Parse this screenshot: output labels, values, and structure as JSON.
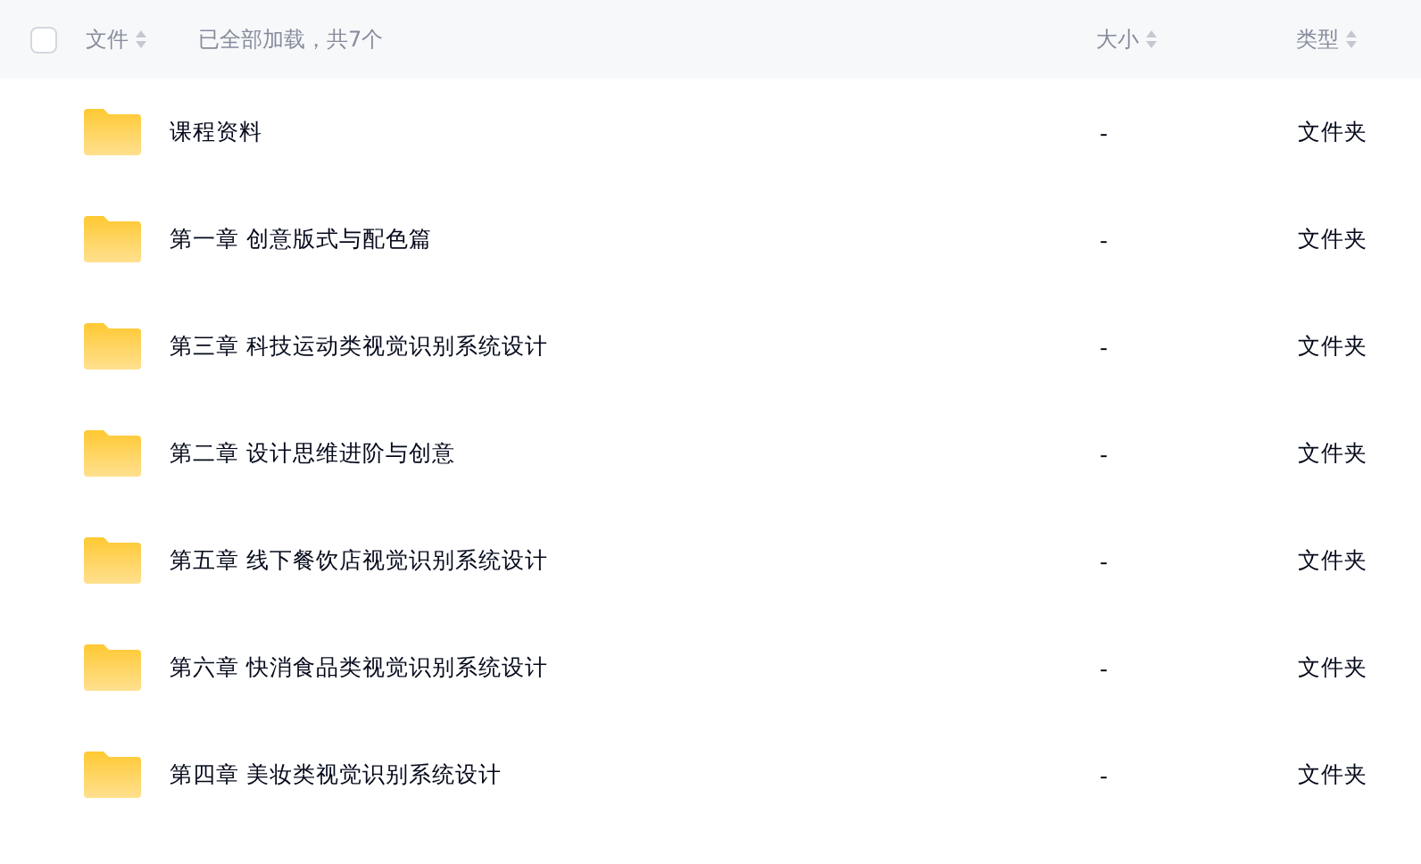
{
  "header": {
    "select_all": {
      "checked": false
    },
    "name_label": "文件",
    "status": "已全部加载，共7个",
    "size_label": "大小",
    "type_label": "类型"
  },
  "rows": [
    {
      "name": "课程资料",
      "size": "-",
      "type": "文件夹"
    },
    {
      "name": "第一章 创意版式与配色篇",
      "size": "-",
      "type": "文件夹"
    },
    {
      "name": "第三章 科技运动类视觉识别系统设计",
      "size": "-",
      "type": "文件夹"
    },
    {
      "name": "第二章 设计思维进阶与创意",
      "size": "-",
      "type": "文件夹"
    },
    {
      "name": "第五章 线下餐饮店视觉识别系统设计",
      "size": "-",
      "type": "文件夹"
    },
    {
      "name": "第六章 快消食品类视觉识别系统设计",
      "size": "-",
      "type": "文件夹"
    },
    {
      "name": "第四章 美妆类视觉识别系统设计",
      "size": "-",
      "type": "文件夹"
    }
  ]
}
